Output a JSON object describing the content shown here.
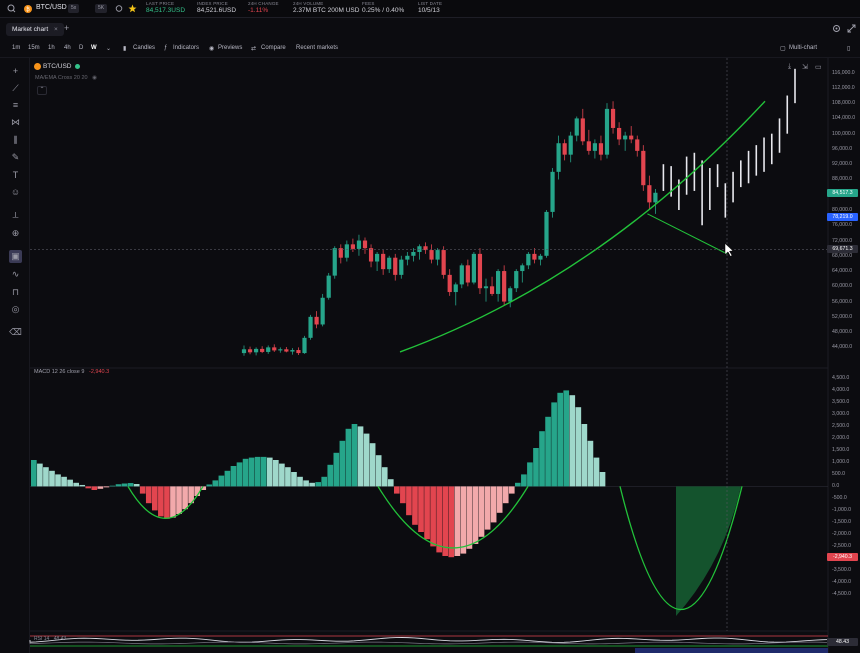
{
  "topbar": {
    "symbol": "BTC/USD",
    "market_tag": "5x",
    "mode_tag": "5K",
    "stats": [
      {
        "label": "LAST PRICE",
        "value": "84,517.3USD",
        "color": "#34c28a"
      },
      {
        "label": "INDEX PRICE",
        "value": "84,521.6USD",
        "color": "#d0d0d8"
      },
      {
        "label": "24H CHANGE",
        "value": "-1.11%",
        "color": "#e2454f"
      },
      {
        "label": "24H VOLUME",
        "value": "2.37M BTC  200M USD",
        "color": "#d0d0d8"
      },
      {
        "label": "FEES",
        "value": "0.25% / 0.40%",
        "color": "#d0d0d8"
      },
      {
        "label": "LIST DATE",
        "value": "10/5/13",
        "color": "#d0d0d8"
      }
    ]
  },
  "tabs": {
    "active": "Market chart",
    "close": "×",
    "add": "+"
  },
  "toolbar": {
    "timeframes": [
      "1m",
      "15m",
      "1h",
      "4h",
      "D",
      "W"
    ],
    "active_timeframe": "W",
    "items": [
      "Candles",
      "Indicators",
      "Previews",
      "Compare",
      "Recent markets"
    ],
    "multi_chart": "Multi-chart"
  },
  "legend": {
    "symbol": "BTC/USD",
    "indicator": "MA/EMA Cross 20 20",
    "macd_label": "MACD 12 26 close 9",
    "macd_value": "-2,940.3"
  },
  "bottom_indicator": {
    "label": "RSI 14",
    "value": "48.43",
    "badge": "48.43"
  },
  "colors": {
    "up": "#26a58a",
    "down": "#e2454f",
    "hist_light_up": "#9fd8cb",
    "hist_light_down": "#f2a9ab",
    "curve": "#22c23a",
    "bg": "#0c0c10"
  },
  "chart_data": [
    {
      "type": "candlestick",
      "title": "",
      "price_ticks": [
        "116,000.0",
        "112,000.0",
        "108,000.0",
        "104,000.0",
        "100,000.0",
        "96,000.0",
        "92,000.0",
        "88,000.0",
        "84,000.0",
        "80,000.0",
        "76,000.0",
        "72,000.0",
        "68,000.0",
        "64,000.0",
        "60,000.0",
        "56,000.0",
        "52,000.0",
        "48,000.0",
        "44,000.0"
      ],
      "ylim": [
        42000,
        118000
      ],
      "last_price_badge": "84,517.3",
      "crosshair_price_badge": "78,219.0",
      "cursor_price_badge": "69,671.3",
      "candles": [
        [
          42500,
          44500,
          41800,
          43500
        ],
        [
          43500,
          44200,
          42200,
          42700
        ],
        [
          42700,
          44000,
          41900,
          43600
        ],
        [
          43600,
          44300,
          42500,
          42800
        ],
        [
          42800,
          44500,
          42300,
          44000
        ],
        [
          44000,
          44800,
          42800,
          43200
        ],
        [
          43200,
          44000,
          42600,
          43500
        ],
        [
          43500,
          44100,
          42700,
          42900
        ],
        [
          42900,
          43800,
          42100,
          43300
        ],
        [
          43300,
          44000,
          42000,
          42500
        ],
        [
          42500,
          47000,
          42300,
          46500
        ],
        [
          46500,
          52500,
          46000,
          52000
        ],
        [
          52000,
          53500,
          49000,
          50000
        ],
        [
          50000,
          58000,
          49500,
          57000
        ],
        [
          57000,
          63500,
          56500,
          62800
        ],
        [
          62800,
          70500,
          62000,
          70000
        ],
        [
          70000,
          71000,
          66000,
          67500
        ],
        [
          67500,
          72000,
          66500,
          71000
        ],
        [
          71000,
          72500,
          69000,
          69800
        ],
        [
          69800,
          73500,
          68000,
          72000
        ],
        [
          72000,
          72800,
          68500,
          70000
        ],
        [
          70000,
          71000,
          65000,
          66500
        ],
        [
          66500,
          69000,
          64000,
          68500
        ],
        [
          68500,
          69500,
          63000,
          64500
        ],
        [
          64500,
          68000,
          63500,
          67500
        ],
        [
          67500,
          68500,
          61500,
          63000
        ],
        [
          63000,
          68000,
          62000,
          67000
        ],
        [
          67000,
          69000,
          65500,
          68000
        ],
        [
          68000,
          70000,
          66500,
          69000
        ],
        [
          69000,
          71000,
          67000,
          70500
        ],
        [
          70500,
          71500,
          68500,
          69500
        ],
        [
          69500,
          71000,
          66000,
          67000
        ],
        [
          67000,
          70000,
          65500,
          69500
        ],
        [
          69500,
          70500,
          62000,
          63000
        ],
        [
          63000,
          64500,
          57500,
          58500
        ],
        [
          58500,
          61000,
          55000,
          60500
        ],
        [
          60500,
          66000,
          59500,
          65500
        ],
        [
          65500,
          67000,
          60000,
          61000
        ],
        [
          61000,
          69000,
          60500,
          68500
        ],
        [
          68500,
          70000,
          58000,
          59500
        ],
        [
          59500,
          62000,
          56000,
          60000
        ],
        [
          60000,
          62500,
          57500,
          58000
        ],
        [
          58000,
          64500,
          56000,
          64000
        ],
        [
          64000,
          65500,
          55000,
          56000
        ],
        [
          56000,
          60000,
          54500,
          59500
        ],
        [
          59500,
          64500,
          58500,
          64000
        ],
        [
          64000,
          66000,
          61000,
          65500
        ],
        [
          65500,
          69000,
          64500,
          68500
        ],
        [
          68500,
          70000,
          66000,
          67000
        ],
        [
          67000,
          68500,
          65500,
          68000
        ],
        [
          68000,
          80000,
          67500,
          79500
        ],
        [
          79500,
          91000,
          78000,
          90000
        ],
        [
          90000,
          99500,
          88000,
          97500
        ],
        [
          97500,
          98500,
          93000,
          94500
        ],
        [
          94500,
          100500,
          92500,
          99500
        ],
        [
          99500,
          104500,
          98000,
          104000
        ],
        [
          104000,
          106500,
          97000,
          98000
        ],
        [
          98000,
          101000,
          94500,
          95500
        ],
        [
          95500,
          98500,
          93500,
          97500
        ],
        [
          97500,
          99500,
          93000,
          94500
        ],
        [
          94500,
          108000,
          93500,
          106500
        ],
        [
          106500,
          108500,
          100000,
          101500
        ],
        [
          101500,
          103000,
          97000,
          98500
        ],
        [
          98500,
          100500,
          95500,
          99500
        ],
        [
          99500,
          102000,
          97500,
          98500
        ],
        [
          98500,
          99500,
          94000,
          95500
        ],
        [
          95500,
          97000,
          85000,
          86500
        ],
        [
          86500,
          89000,
          80000,
          82000
        ],
        [
          82000,
          85500,
          79000,
          84517
        ]
      ],
      "ghost_bars": [
        [
          85000,
          92000
        ],
        [
          83500,
          91500
        ],
        [
          80000,
          88000
        ],
        [
          84000,
          94000
        ],
        [
          85000,
          95000
        ],
        [
          76000,
          93000
        ],
        [
          80000,
          91000
        ],
        [
          86000,
          92000
        ],
        [
          78000,
          87000
        ],
        [
          82000,
          90000
        ],
        [
          86000,
          93000
        ],
        [
          87000,
          95500
        ],
        [
          89000,
          97000
        ],
        [
          90000,
          99000
        ],
        [
          92000,
          100000
        ],
        [
          95000,
          104000
        ],
        [
          100000,
          110000
        ],
        [
          108000,
          117000
        ]
      ]
    },
    {
      "type": "bar",
      "title": "",
      "ylim": [
        -5400,
        4600
      ],
      "ticks": [
        "4,500.0",
        "4,000.0",
        "3,500.0",
        "3,000.0",
        "2,500.0",
        "2,000.0",
        "1,500.0",
        "1,000.0",
        "500.0",
        "0.0",
        "-500.0",
        "-1,000.0",
        "-1,500.0",
        "-2,000.0",
        "-2,500.0",
        "-3,000.0",
        "-3,500.0",
        "-4,000.0",
        "-4,500.0"
      ],
      "last_value_badge": "-2,940.3",
      "histogram": [
        1100,
        950,
        800,
        650,
        500,
        400,
        280,
        150,
        60,
        -80,
        -150,
        -100,
        -40,
        30,
        90,
        120,
        140,
        100,
        -300,
        -700,
        -1000,
        -1250,
        -1350,
        -1300,
        -1150,
        -950,
        -700,
        -400,
        -150,
        80,
        250,
        450,
        650,
        850,
        1000,
        1150,
        1200,
        1230,
        1230,
        1200,
        1100,
        950,
        800,
        600,
        400,
        250,
        150,
        180,
        400,
        900,
        1400,
        1900,
        2400,
        2600,
        2500,
        2200,
        1800,
        1300,
        800,
        300,
        -300,
        -700,
        -1200,
        -1600,
        -1900,
        -2200,
        -2500,
        -2750,
        -2900,
        -2950,
        -2900,
        -2800,
        -2600,
        -2400,
        -2100,
        -1800,
        -1500,
        -1100,
        -700,
        -300,
        150,
        500,
        1000,
        1600,
        2300,
        2900,
        3500,
        3900,
        4000,
        3800,
        3300,
        2600,
        1900,
        1200,
        600
      ],
      "projected_trough": [
        -5400,
        -3600
      ]
    }
  ]
}
